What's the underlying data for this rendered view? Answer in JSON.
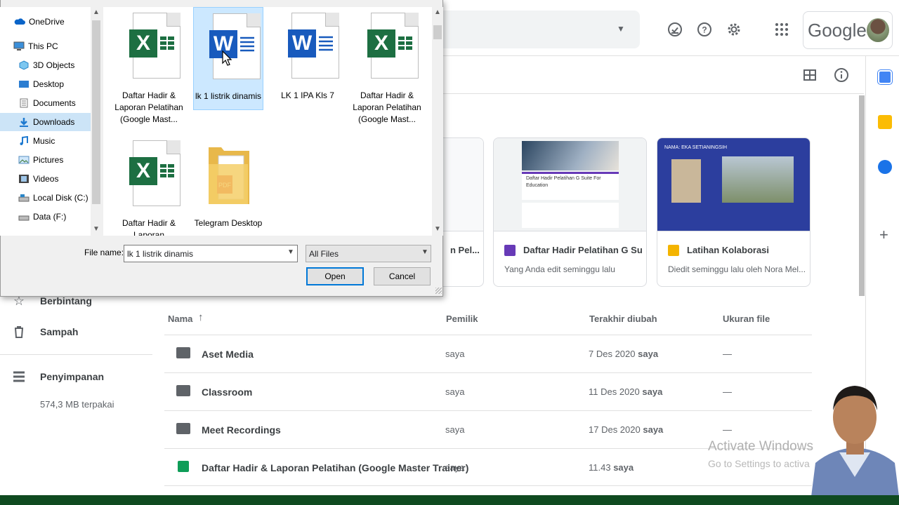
{
  "drive": {
    "brand": "Google",
    "sidebar": {
      "starred": "Berbintang",
      "trash": "Sampah",
      "storage": "Penyimpanan",
      "storage_used": "574,3 MB terpakai"
    },
    "suggested": [
      {
        "title": "n Pel...",
        "subtitle": ""
      },
      {
        "title": "Daftar Hadir Pelatihan G Su...",
        "subtitle": "Yang Anda edit seminggu lalu"
      },
      {
        "title": "Latihan Kolaborasi",
        "subtitle": "Diedit seminggu lalu oleh Nora Mel..."
      }
    ],
    "thumb_texts": {
      "form_title": "Daftar Hadir Pelatihan G Suite For Education",
      "slide_caption": "NAMA: EKA SETIANINGSIH"
    },
    "columns": {
      "name": "Nama",
      "owner": "Pemilik",
      "modified": "Terakhir diubah",
      "size": "Ukuran file"
    },
    "rows": [
      {
        "name": "Aset Media",
        "owner": "saya",
        "date": "7 Des 2020",
        "by": "saya",
        "size": "—",
        "icon": "shared-folder-icon"
      },
      {
        "name": "Classroom",
        "owner": "saya",
        "date": "11 Des 2020",
        "by": "saya",
        "size": "—",
        "icon": "folder-icon"
      },
      {
        "name": "Meet Recordings",
        "owner": "saya",
        "date": "17 Des 2020",
        "by": "saya",
        "size": "—",
        "icon": "folder-icon"
      },
      {
        "name": "Daftar Hadir & Laporan Pelatihan (Google Master Trainer)",
        "owner": "saya",
        "date": "11.43",
        "by": "saya",
        "size": "",
        "icon": "sheets-icon"
      }
    ],
    "watermark": {
      "line1": "Activate Windows",
      "line2": "Go to Settings to activa"
    }
  },
  "dialog": {
    "tree": [
      {
        "label": "OneDrive",
        "icon": "cloud-icon",
        "selected": false
      },
      {
        "label": "This PC",
        "icon": "computer-icon",
        "selected": false
      },
      {
        "label": "3D Objects",
        "icon": "cube-icon",
        "selected": false
      },
      {
        "label": "Desktop",
        "icon": "desktop-icon",
        "selected": false
      },
      {
        "label": "Documents",
        "icon": "documents-icon",
        "selected": false
      },
      {
        "label": "Downloads",
        "icon": "download-icon",
        "selected": true
      },
      {
        "label": "Music",
        "icon": "music-icon",
        "selected": false
      },
      {
        "label": "Pictures",
        "icon": "pictures-icon",
        "selected": false
      },
      {
        "label": "Videos",
        "icon": "videos-icon",
        "selected": false
      },
      {
        "label": "Local Disk (C:)",
        "icon": "disk-icon",
        "selected": false
      },
      {
        "label": "Data (F:)",
        "icon": "drive-icon",
        "selected": false
      }
    ],
    "files": [
      {
        "label": "Daftar Hadir & Laporan Pelatihan (Google Mast...",
        "type": "excel",
        "selected": false
      },
      {
        "label": "lk 1 listrik dinamis",
        "type": "word",
        "selected": true
      },
      {
        "label": "LK 1 IPA Kls 7",
        "type": "word",
        "selected": false
      },
      {
        "label": "Daftar Hadir & Laporan Pelatihan (Google Mast...",
        "type": "excel",
        "selected": false
      },
      {
        "label": "Daftar Hadir & Laporan",
        "type": "excel",
        "selected": false
      },
      {
        "label": "Telegram Desktop",
        "type": "folder",
        "selected": false
      }
    ],
    "filename_label": "File name:",
    "filename_value": "lk 1 listrik dinamis",
    "filter_value": "All Files",
    "open_label": "Open",
    "cancel_label": "Cancel",
    "colors": {
      "excel": "#1d6f42",
      "word": "#185abd",
      "selection": "#cce8ff",
      "accent": "#0078d7"
    }
  }
}
